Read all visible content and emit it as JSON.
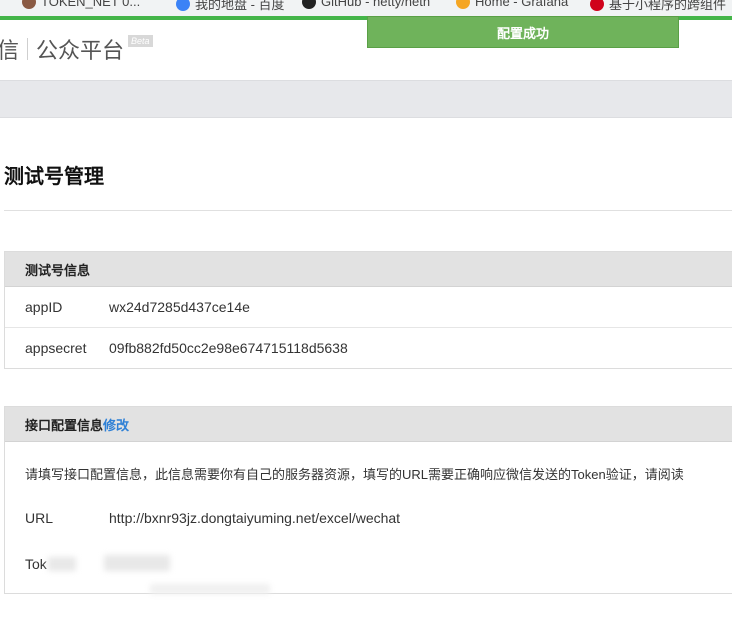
{
  "browser": {
    "bookmarks": [
      "TOKEN_NET 0...",
      "我的地盘 - 百度",
      "GitHub - netty/neth",
      "Home - Grafana",
      "基于小程序的跨组件"
    ]
  },
  "brand": {
    "prefix": "信",
    "name": "公众平台",
    "badge": "Beta"
  },
  "toast": {
    "message": "配置成功"
  },
  "page": {
    "title": "测试号管理"
  },
  "test_account": {
    "header": "测试号信息",
    "rows": [
      {
        "label": "appID",
        "value": "wx24d7285d437ce14e"
      },
      {
        "label": "appsecret",
        "value": "09fb882fd50cc2e98e674715118d5638"
      }
    ]
  },
  "interface_config": {
    "header": "接口配置信息",
    "edit_link": "修改",
    "description": "请填写接口配置信息，此信息需要你有自己的服务器资源，填写的URL需要正确响应微信发送的Token验证，请阅读",
    "rows": [
      {
        "label": "URL",
        "value": "http://bxnr93jz.dongtaiyuming.net/excel/wechat"
      },
      {
        "label": "Tok",
        "value": ""
      }
    ]
  }
}
